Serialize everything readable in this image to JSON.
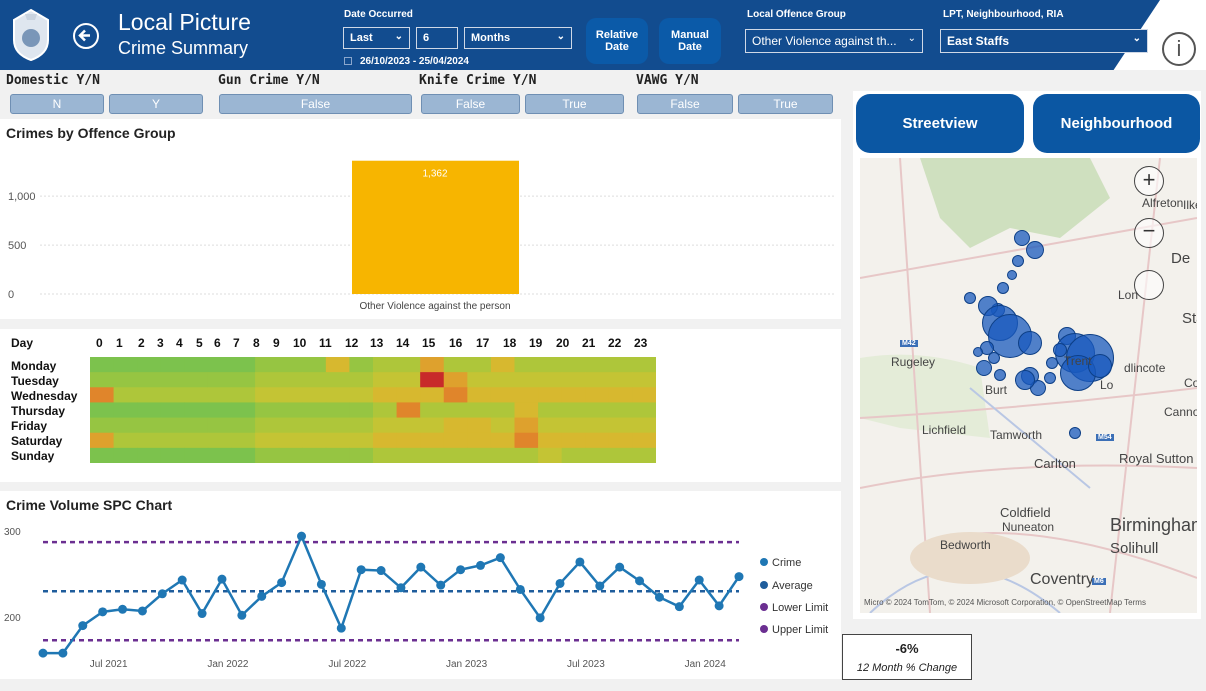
{
  "header": {
    "title": "Local Picture",
    "subtitle": "Crime Summary"
  },
  "date_filter": {
    "label": "Date Occurred",
    "period": "Last",
    "amount": "6",
    "unit": "Months",
    "range": "26/10/2023 - 25/04/2024"
  },
  "relative_date_btn": "Relative Date",
  "manual_date_btn": "Manual Date",
  "offence_filter": {
    "label": "Local Offence Group",
    "value": "Other Violence against th..."
  },
  "area_filter": {
    "label": "LPT, Neighbourhood, RIA",
    "value": "East Staffs"
  },
  "slicers": {
    "domestic": {
      "label": "Domestic Y/N",
      "options": [
        "N",
        "Y"
      ]
    },
    "gun": {
      "label": "Gun Crime Y/N",
      "options": [
        "False"
      ]
    },
    "knife": {
      "label": "Knife Crime Y/N",
      "options": [
        "False",
        "True"
      ]
    },
    "vawg": {
      "label": "VAWG Y/N",
      "options": [
        "False",
        "True"
      ]
    }
  },
  "bar_title": "Crimes by Offence Group",
  "bar_chart": {
    "type": "bar",
    "categories": [
      "Other Violence against the person"
    ],
    "values": [
      1362
    ],
    "value_label": "1,362",
    "ylabels": [
      "1,000",
      "500",
      "0"
    ],
    "ylim": [
      0,
      1400
    ],
    "color": "#f7b500"
  },
  "heatmap": {
    "corner": "Day",
    "hours": [
      "0",
      "1",
      "2",
      "3",
      "4",
      "5",
      "6",
      "7",
      "8",
      "9",
      "10",
      "11",
      "12",
      "13",
      "14",
      "15",
      "16",
      "17",
      "18",
      "19",
      "20",
      "21",
      "22",
      "23"
    ],
    "days": [
      "Monday",
      "Tuesday",
      "Wednesday",
      "Thursday",
      "Friday",
      "Saturday",
      "Sunday"
    ]
  },
  "spc_title": "Crime Volume SPC Chart",
  "chart_data": {
    "type": "line",
    "x": [
      "Apr 2021",
      "May 2021",
      "Jun 2021",
      "Jul 2021",
      "Aug 2021",
      "Sep 2021",
      "Oct 2021",
      "Nov 2021",
      "Dec 2021",
      "Jan 2022",
      "Feb 2022",
      "Mar 2022",
      "Apr 2022",
      "May 2022",
      "Jun 2022",
      "Jul 2022",
      "Aug 2022",
      "Sep 2022",
      "Oct 2022",
      "Nov 2022",
      "Dec 2022",
      "Jan 2023",
      "Feb 2023",
      "Mar 2023",
      "Apr 2023",
      "May 2023",
      "Jun 2023",
      "Jul 2023",
      "Aug 2023",
      "Sep 2023",
      "Oct 2023",
      "Nov 2023",
      "Dec 2023",
      "Jan 2024",
      "Feb 2024",
      "Mar 2024",
      "Apr 2024"
    ],
    "series": [
      {
        "name": "Crime",
        "values": [
          158,
          158,
          190,
          206,
          209,
          207,
          227,
          243,
          204,
          244,
          202,
          224,
          240,
          294,
          238,
          187,
          255,
          254,
          234,
          258,
          237,
          255,
          260,
          269,
          232,
          199,
          239,
          264,
          236,
          258,
          242,
          223,
          212,
          243,
          213,
          247
        ]
      },
      {
        "name": "Average",
        "values": [
          230
        ]
      },
      {
        "name": "Lower Limit",
        "values": [
          173
        ]
      },
      {
        "name": "Upper Limit",
        "values": [
          287
        ]
      }
    ],
    "ylabels": [
      "300",
      "200"
    ],
    "ylim": [
      150,
      305
    ],
    "xlabels": [
      "Jul 2021",
      "Jan 2022",
      "Jul 2022",
      "Jan 2023",
      "Jul 2023",
      "Jan 2024"
    ],
    "colors": {
      "crime": "#1f77b4",
      "average": "#1f5d9c",
      "limits": "#6b2f91"
    }
  },
  "map_buttons": {
    "streetview": "Streetview",
    "neighbourhood": "Neighbourhood"
  },
  "map_places": [
    "Alfreton",
    "Ilkes",
    "De",
    "Lon",
    "Stafford",
    "Rugeley",
    "Burt",
    "Trent",
    "dlincote",
    "Lo",
    "Coalvill",
    "Cannock",
    "Lichfield",
    "Tamworth",
    "Carlton",
    "Royal Sutton",
    "Coldfield",
    "Nuneaton",
    "Birmingham",
    "Bedworth",
    "Solihull",
    "Coventry",
    "M6",
    "M42",
    "M54"
  ],
  "map_credit": "Micro © 2024 TomTom, © 2024 Microsoft Corporation, © OpenStreetMap Terms",
  "kpi": {
    "value": "-6%",
    "label": "12 Month % Change"
  }
}
